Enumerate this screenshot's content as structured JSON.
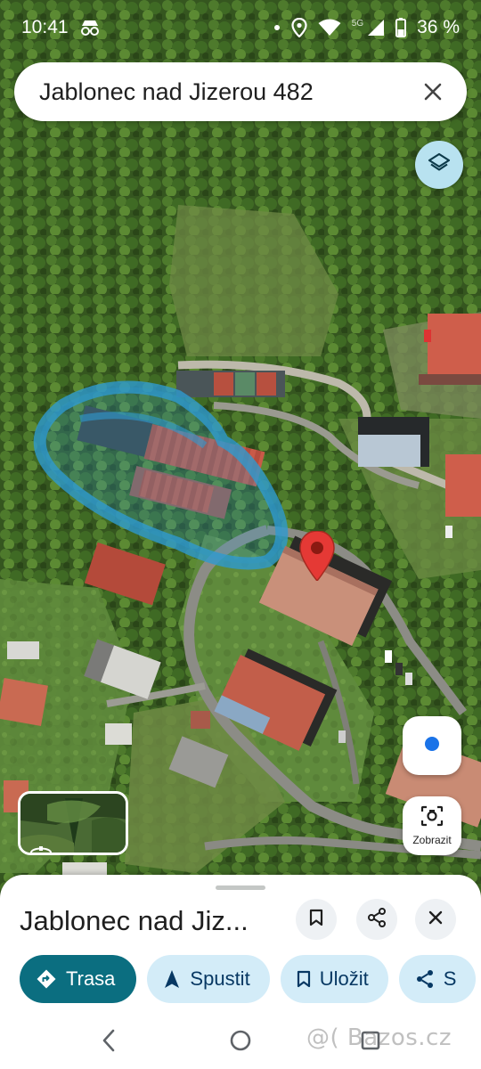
{
  "status_bar": {
    "time": "10:41",
    "network_label": "5G",
    "battery": "36 %",
    "icons": [
      "incognito-icon",
      "dot-icon",
      "location-icon",
      "wifi-icon",
      "signal-icon",
      "battery-icon"
    ]
  },
  "search": {
    "query": "Jablonec nad Jizerou 482",
    "clear_icon": "close-icon"
  },
  "map": {
    "type": "satellite",
    "marker_icon": "red-location-pin",
    "highlight_color": "#2e9ad0",
    "layers_icon": "layers-icon"
  },
  "controls": {
    "my_location_icon": "my-location-dot-icon",
    "lens_label": "Zobrazit",
    "lens_icon": "camera-lens-icon",
    "streetview_icon": "street-view-360-icon"
  },
  "place": {
    "title": "Jablonec nad Jiz...",
    "actions": {
      "save_icon": "bookmark-icon",
      "share_icon": "share-icon",
      "close_icon": "close-icon"
    }
  },
  "chips": [
    {
      "label": "Trasa",
      "icon": "directions-icon"
    },
    {
      "label": "Spustit",
      "icon": "navigation-arrow-icon"
    },
    {
      "label": "Uložit",
      "icon": "bookmark-icon"
    },
    {
      "label": "S",
      "icon": "share-icon"
    }
  ],
  "nav": {
    "watermark": "@( Bazos.cz",
    "icons": [
      "back-icon",
      "home-icon",
      "recents-icon"
    ]
  },
  "colors": {
    "primary_chip": "#0b6e80",
    "chip_bg": "#d3ecf8",
    "marker": "#e53935",
    "my_location": "#1a73e8"
  }
}
